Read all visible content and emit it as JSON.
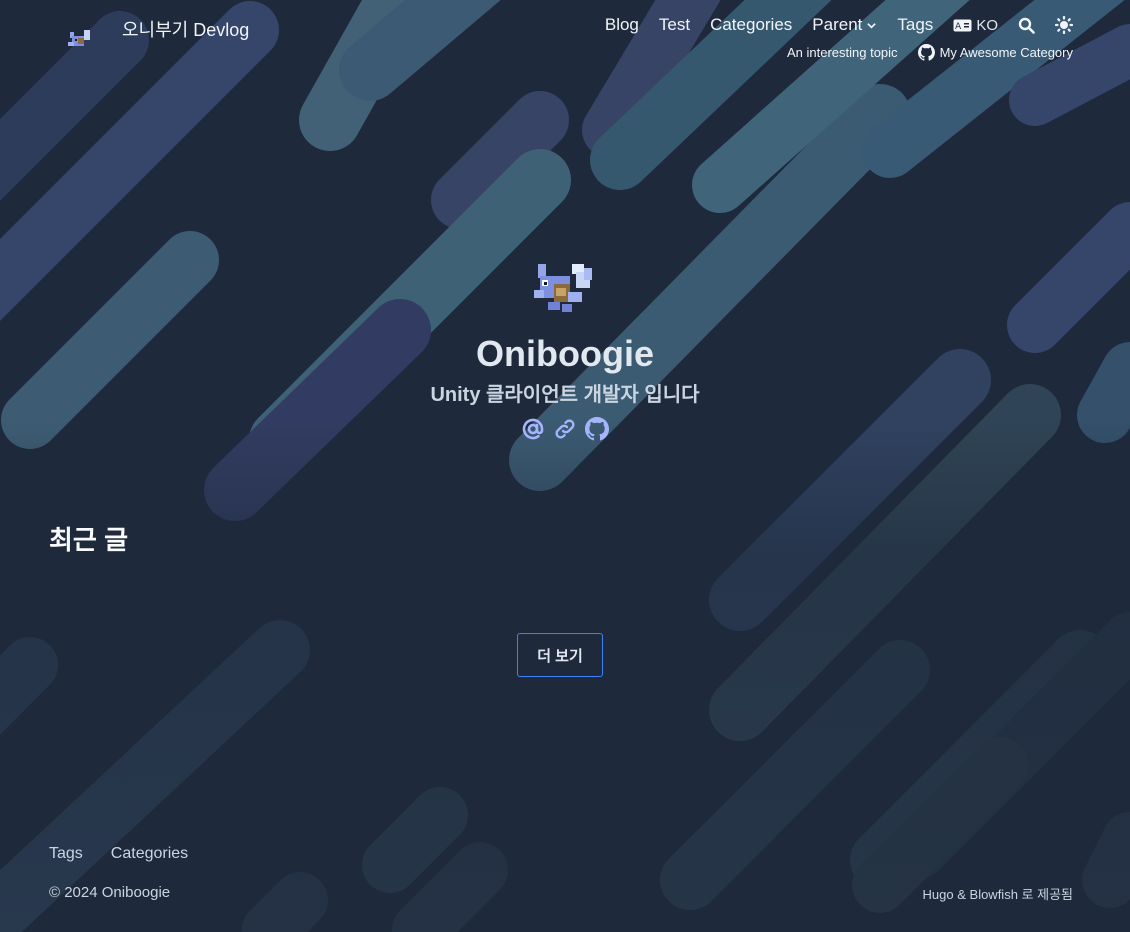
{
  "header": {
    "site_title": "오니부기 Devlog",
    "nav": {
      "blog": "Blog",
      "test": "Test",
      "categories": "Categories",
      "parent": "Parent",
      "tags": "Tags",
      "language": "KO"
    },
    "subnav": {
      "topic": "An interesting topic",
      "category": "My Awesome Category"
    }
  },
  "hero": {
    "name": "Oniboogie",
    "bio": "Unity 클라이언트 개발자 입니다",
    "socials": [
      "at-icon",
      "link-icon",
      "github-icon"
    ]
  },
  "recent": {
    "title": "최근 글",
    "more_button": "더 보기"
  },
  "footer": {
    "links": [
      "Tags",
      "Categories"
    ],
    "copyright": "© 2024 Oniboogie",
    "powered_by": "Hugo & Blowfish 로 제공됨"
  },
  "colors": {
    "background": "#1e293b",
    "accent": "#3b82f6",
    "icon": "#a5b4fc"
  }
}
